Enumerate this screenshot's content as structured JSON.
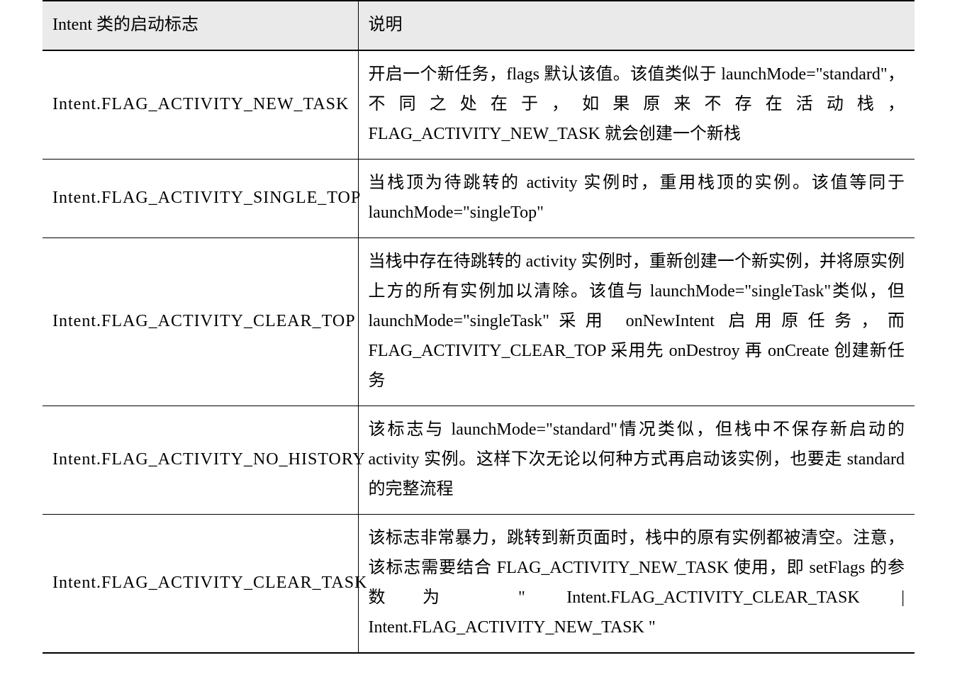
{
  "table": {
    "headers": {
      "flag": "Intent 类的启动标志",
      "desc": "说明"
    },
    "rows": [
      {
        "flag": "Intent.FLAG_ACTIVITY_NEW_TASK",
        "desc": "开启一个新任务，flags 默认该值。该值类似于 launchMode=\"standard\"，不同之处在于，如果原来不存在活动栈，FLAG_ACTIVITY_NEW_TASK 就会创建一个新栈"
      },
      {
        "flag": "Intent.FLAG_ACTIVITY_SINGLE_TOP",
        "desc": "当栈顶为待跳转的 activity 实例时，重用栈顶的实例。该值等同于 launchMode=\"singleTop\""
      },
      {
        "flag": "Intent.FLAG_ACTIVITY_CLEAR_TOP",
        "desc": "当栈中存在待跳转的 activity 实例时，重新创建一个新实例，并将原实例上方的所有实例加以清除。该值与 launchMode=\"singleTask\"类似，但 launchMode=\"singleTask\"采用 onNewIntent 启用原任务，而 FLAG_ACTIVITY_CLEAR_TOP 采用先 onDestroy 再 onCreate 创建新任务"
      },
      {
        "flag": "Intent.FLAG_ACTIVITY_NO_HISTORY",
        "desc": "该标志与 launchMode=\"standard\"情况类似，但栈中不保存新启动的 activity 实例。这样下次无论以何种方式再启动该实例，也要走 standard 的完整流程"
      },
      {
        "flag": "Intent.FLAG_ACTIVITY_CLEAR_TASK",
        "desc": "该标志非常暴力，跳转到新页面时，栈中的原有实例都被清空。注意，该标志需要结合 FLAG_ACTIVITY_NEW_TASK 使用，即 setFlags 的参数为 \" Intent.FLAG_ACTIVITY_CLEAR_TASK | Intent.FLAG_ACTIVITY_NEW_TASK \""
      }
    ]
  }
}
